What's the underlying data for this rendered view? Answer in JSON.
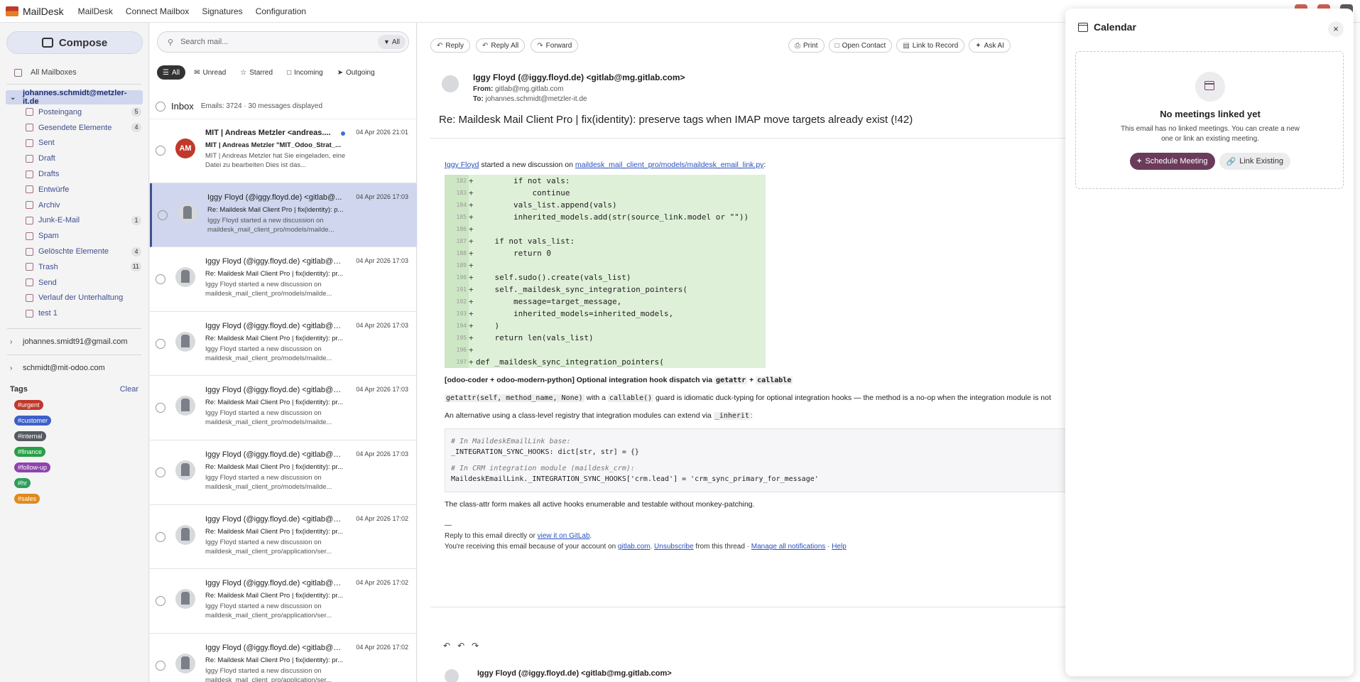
{
  "app": {
    "brand": "MailDesk",
    "nav": [
      "MailDesk",
      "Connect Mailbox",
      "Signatures",
      "Configuration"
    ]
  },
  "sidebar": {
    "compose": "Compose",
    "all_mailboxes": "All Mailboxes",
    "active_account": "johannes.schmidt@metzler-it.de",
    "folders": [
      {
        "label": "Posteingang",
        "count": "5"
      },
      {
        "label": "Gesendete Elemente",
        "count": "4"
      },
      {
        "label": "Sent",
        "count": ""
      },
      {
        "label": "Draft",
        "count": ""
      },
      {
        "label": "Drafts",
        "count": ""
      },
      {
        "label": "Entwürfe",
        "count": ""
      },
      {
        "label": "Archiv",
        "count": ""
      },
      {
        "label": "Junk-E-Mail",
        "count": "1"
      },
      {
        "label": "Spam",
        "count": ""
      },
      {
        "label": "Gelöschte Elemente",
        "count": "4"
      },
      {
        "label": "Trash",
        "count": "11"
      },
      {
        "label": "Send",
        "count": ""
      },
      {
        "label": "Verlauf der Unterhaltung",
        "count": ""
      },
      {
        "label": "test 1",
        "count": ""
      }
    ],
    "other_accounts": [
      "johannes.smidt91@gmail.com",
      "schmidt@mit-odoo.com"
    ],
    "tags_label": "Tags",
    "clear_label": "Clear",
    "tags": [
      {
        "label": "#urgent",
        "color": "#c0392b"
      },
      {
        "label": "#customer",
        "color": "#3f5fc8"
      },
      {
        "label": "#internal",
        "color": "#555a60"
      },
      {
        "label": "#finance",
        "color": "#27a045"
      },
      {
        "label": "#follow-up",
        "color": "#8e44ad"
      },
      {
        "label": "#hr",
        "color": "#2e9e5a"
      },
      {
        "label": "#sales",
        "color": "#e08a1e"
      }
    ]
  },
  "list": {
    "search_placeholder": "Search mail...",
    "search_filter": "All",
    "filters": [
      "All",
      "Unread",
      "Starred",
      "Incoming",
      "Outgoing"
    ],
    "folder_title": "Inbox",
    "count_text": "Emails: 3724 · 30 messages displayed",
    "emails": [
      {
        "from": "MIT | Andreas Metzler <andreas....",
        "date": "04 Apr 2026 21:01",
        "subject": "MIT | Andreas Metzler \"MIT_Odoo_Strat_...",
        "preview": "MIT | Andreas Metzler hat Sie eingeladen, eine Datei zu bearbeiten Dies ist das...",
        "initials": "AM",
        "unread": true
      },
      {
        "from": "Iggy Floyd (@iggy.floyd.de) <gitlab@...",
        "date": "04 Apr 2026 17:03",
        "subject": "Re: Maildesk Mail Client Pro | fix(identity): p...",
        "preview": "Iggy Floyd started a new discussion on maildesk_mail_client_pro/models/mailde...",
        "initials": "",
        "unread": false
      },
      {
        "from": "Iggy Floyd (@iggy.floyd.de) <gitlab@m...",
        "date": "04 Apr 2026 17:03",
        "subject": "Re: Maildesk Mail Client Pro | fix(identity): pr...",
        "preview": "Iggy Floyd started a new discussion on maildesk_mail_client_pro/models/mailde...",
        "initials": "",
        "unread": false
      },
      {
        "from": "Iggy Floyd (@iggy.floyd.de) <gitlab@m...",
        "date": "04 Apr 2026 17:03",
        "subject": "Re: Maildesk Mail Client Pro | fix(identity): pr...",
        "preview": "Iggy Floyd started a new discussion on maildesk_mail_client_pro/models/mailde...",
        "initials": "",
        "unread": false
      },
      {
        "from": "Iggy Floyd (@iggy.floyd.de) <gitlab@m...",
        "date": "04 Apr 2026 17:03",
        "subject": "Re: Maildesk Mail Client Pro | fix(identity): pr...",
        "preview": "Iggy Floyd started a new discussion on maildesk_mail_client_pro/models/mailde...",
        "initials": "",
        "unread": false
      },
      {
        "from": "Iggy Floyd (@iggy.floyd.de) <gitlab@m...",
        "date": "04 Apr 2026 17:03",
        "subject": "Re: Maildesk Mail Client Pro | fix(identity): pr...",
        "preview": "Iggy Floyd started a new discussion on maildesk_mail_client_pro/models/mailde...",
        "initials": "",
        "unread": false
      },
      {
        "from": "Iggy Floyd (@iggy.floyd.de) <gitlab@m...",
        "date": "04 Apr 2026 17:02",
        "subject": "Re: Maildesk Mail Client Pro | fix(identity): pr...",
        "preview": "Iggy Floyd started a new discussion on maildesk_mail_client_pro/application/ser...",
        "initials": "",
        "unread": false
      },
      {
        "from": "Iggy Floyd (@iggy.floyd.de) <gitlab@m...",
        "date": "04 Apr 2026 17:02",
        "subject": "Re: Maildesk Mail Client Pro | fix(identity): pr...",
        "preview": "Iggy Floyd started a new discussion on maildesk_mail_client_pro/application/ser...",
        "initials": "",
        "unread": false
      },
      {
        "from": "Iggy Floyd (@iggy.floyd.de) <gitlab@m...",
        "date": "04 Apr 2026 17:02",
        "subject": "Re: Maildesk Mail Client Pro | fix(identity): pr...",
        "preview": "Iggy Floyd started a new discussion on maildesk_mail_client_pro/application/ser...",
        "initials": "",
        "unread": false
      }
    ]
  },
  "reader": {
    "actions": [
      "Reply",
      "Reply All",
      "Forward"
    ],
    "actions2": [
      "Print",
      "Open Contact",
      "Link to Record",
      "Ask AI"
    ],
    "from": "Iggy Floyd (@iggy.floyd.de) <gitlab@mg.gitlab.com>",
    "from_label": "From:",
    "from_value": "gitlab@mg.gitlab.com",
    "to_label": "To:",
    "to_value": "johannes.schmidt@metzler-it.de",
    "subject": "Re: Maildesk Mail Client Pro | fix(identity): preserve tags when IMAP move targets already exist (!42)",
    "intro_user": "Iggy Floyd",
    "intro_text": " started a new discussion on ",
    "intro_file": "maildesk_mail_client_pro/models/maildesk_email_link.py",
    "intro_end": ":",
    "code_lines": [
      {
        "n": "182",
        "t": "        if not vals:"
      },
      {
        "n": "183",
        "t": "            continue"
      },
      {
        "n": "184",
        "t": "        vals_list.append(vals)"
      },
      {
        "n": "185",
        "t": "        inherited_models.add(str(source_link.model or \"\"))"
      },
      {
        "n": "186",
        "t": ""
      },
      {
        "n": "187",
        "t": "    if not vals_list:"
      },
      {
        "n": "188",
        "t": "        return 0"
      },
      {
        "n": "189",
        "t": ""
      },
      {
        "n": "190",
        "t": "    self.sudo().create(vals_list)"
      },
      {
        "n": "191",
        "t": "    self._maildesk_sync_integration_pointers("
      },
      {
        "n": "192",
        "t": "        message=target_message,"
      },
      {
        "n": "193",
        "t": "        inherited_models=inherited_models,"
      },
      {
        "n": "194",
        "t": "    )"
      },
      {
        "n": "195",
        "t": "    return len(vals_list)"
      },
      {
        "n": "196",
        "t": ""
      },
      {
        "n": "197",
        "t": "def _maildesk_sync_integration_pointers("
      }
    ],
    "p1_bold": "[odoo-coder + odoo-modern-python] Optional integration hook dispatch via ",
    "p1_code1": "getattr",
    "p1_plus": " + ",
    "p1_code2": "callable",
    "p2_code1": "getattr(self, method_name, None)",
    "p2_mid": " with a ",
    "p2_code2": "callable()",
    "p2_text": " guard is idiomatic duck-typing for optional integration hooks — the method is a no-op when the integration module is not",
    "p3_text": "An alternative using a class-level registry that integration modules can extend via ",
    "p3_code": "_inherit",
    "p3_end": ":",
    "cb_c1": "# In MaildeskEmailLink base:",
    "cb_l1": "_INTEGRATION_SYNC_HOOKS: dict[str, str] = {}",
    "cb_c2": "# In CRM integration module (maildesk_crm):",
    "cb_l2": "MaildeskEmailLink._INTEGRATION_SYNC_HOOKS['crm.lead'] = 'crm_sync_primary_for_message'",
    "p4": "The class-attr form makes all active hooks enumerable and testable without monkey-patching.",
    "dashes": "—",
    "f1_text": "Reply to this email directly or ",
    "f1_link": "view it on GitLab",
    "f1_end": ".",
    "f2_text": "You're receiving this email because of your account on ",
    "f2_link1": "gitlab.com",
    "f2_sep1": ". ",
    "f2_link2": "Unsubscribe",
    "f2_mid": " from this thread · ",
    "f2_link3": "Manage all notifications",
    "f2_sep2": " · ",
    "f2_link4": "Help",
    "second_from": "Iggy Floyd (@iggy.floyd.de) <gitlab@mg.gitlab.com>"
  },
  "calendar": {
    "title": "Calendar",
    "close": "×",
    "empty_title": "No meetings linked yet",
    "empty_desc": "This email has no linked meetings. You can create a new one or link an existing meeting.",
    "schedule": "Schedule Meeting",
    "link_existing": "Link Existing"
  }
}
